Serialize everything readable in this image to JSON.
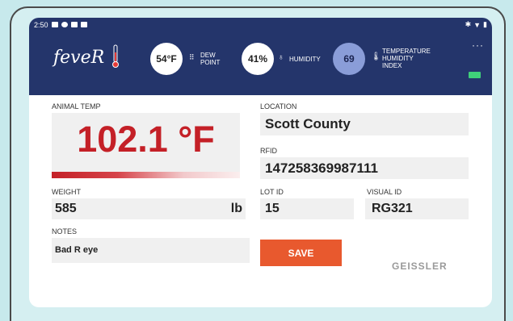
{
  "status_bar": {
    "time": "2:50"
  },
  "header": {
    "logo_text": "feveR",
    "dew_point": {
      "value": "54°F",
      "label_line1": "DEW",
      "label_line2": "POINT"
    },
    "humidity": {
      "value": "41%",
      "label": "HUMIDITY"
    },
    "thi": {
      "value": "69",
      "label_line1": "TEMPERATURE",
      "label_line2": "HUMIDITY",
      "label_line3": "INDEX"
    },
    "menu": "···"
  },
  "form": {
    "animal_temp_label": "ANIMAL TEMP",
    "animal_temp_value": "102.1 °F",
    "location_label": "LOCATION",
    "location_value": "Scott County",
    "rfid_label": "RFID",
    "rfid_value": "147258369987111",
    "weight_label": "WEIGHT",
    "weight_value": "585",
    "weight_unit": "lb",
    "lot_id_label": "LOT ID",
    "lot_id_value": "15",
    "visual_id_label": "VISUAL ID",
    "visual_id_value": "RG321",
    "notes_label": "NOTES",
    "notes_value": "Bad R eye",
    "save_label": "SAVE",
    "brand": "GEISSLER"
  },
  "colors": {
    "header_bg": "#24356b",
    "temp_red": "#c42027",
    "save_orange": "#e8592e",
    "accent_badge": "#8a9dd8"
  }
}
